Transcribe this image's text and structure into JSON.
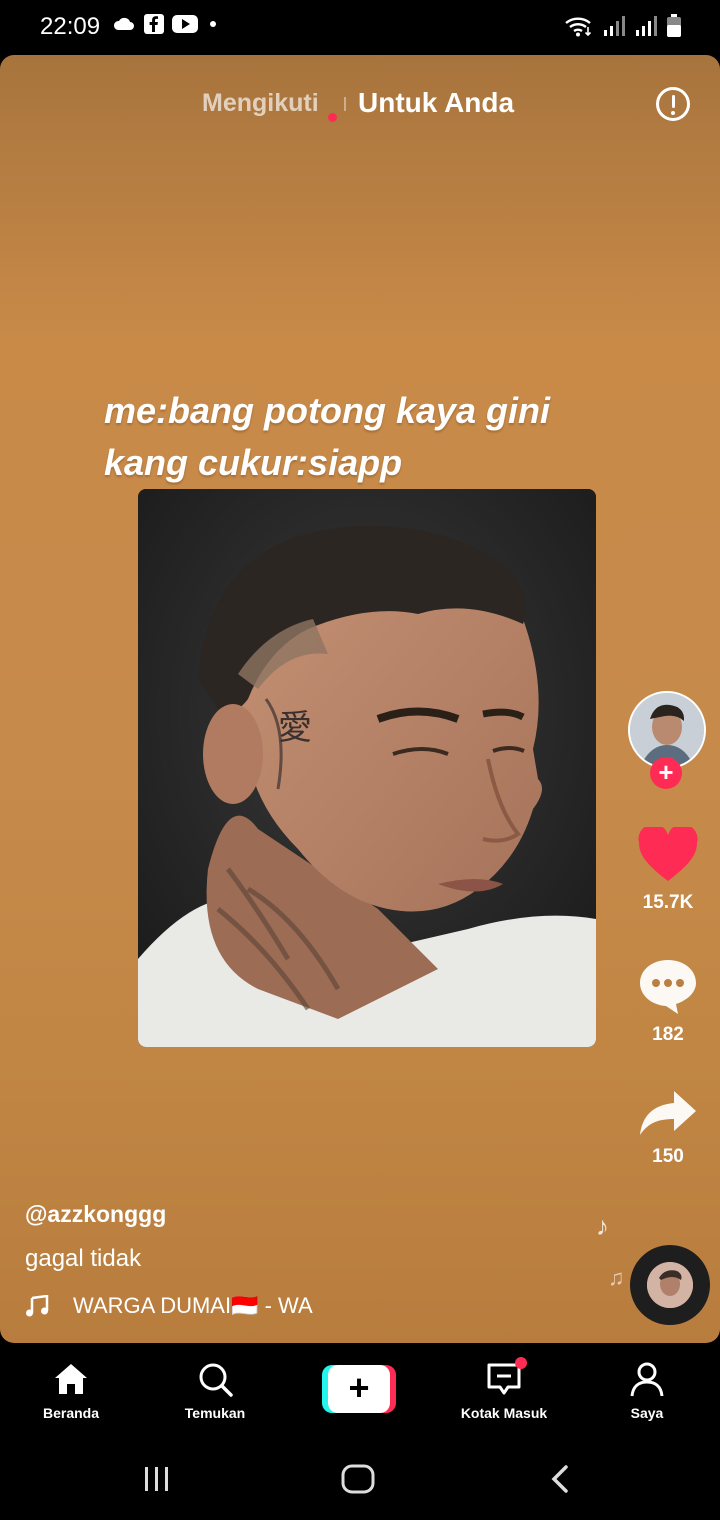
{
  "status_bar": {
    "time": "22:09",
    "left_icons": [
      "cloud-icon",
      "facebook-icon",
      "youtube-icon",
      "dot-icon"
    ],
    "right_icons": [
      "wifi-icon",
      "signal-icon",
      "signal-icon",
      "battery-icon"
    ]
  },
  "top_tabs": {
    "following": "Mengikuti",
    "for_you": "Untuk Anda"
  },
  "overlay_text": {
    "line1": "me:bang potong kaya gini",
    "line2": "kang cukur:siapp"
  },
  "actions": {
    "likes": "15.7K",
    "comments": "182",
    "shares": "150"
  },
  "video_info": {
    "username": "@azzkonggg",
    "caption": "gagal tidak",
    "music": "WARGA DUMAI🇮🇩 - WA"
  },
  "bottom_nav": {
    "items": [
      {
        "label": "Beranda",
        "icon": "home-icon"
      },
      {
        "label": "Temukan",
        "icon": "search-icon"
      },
      {
        "label": "",
        "icon": "plus-icon"
      },
      {
        "label": "Kotak Masuk",
        "icon": "inbox-icon"
      },
      {
        "label": "Saya",
        "icon": "profile-icon"
      }
    ]
  },
  "colors": {
    "accent": "#fe2c55",
    "cyan": "#25f4ee",
    "background_video": "#c68a4b"
  }
}
